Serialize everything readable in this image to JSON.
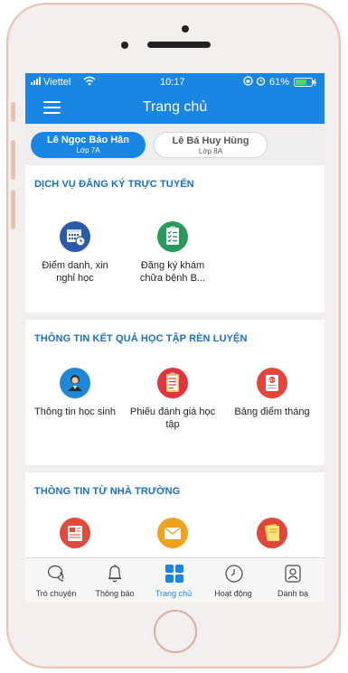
{
  "status": {
    "carrier": "Viettel",
    "time": "10:17",
    "battery": "61%"
  },
  "appbar": {
    "title": "Trang chủ"
  },
  "students": [
    {
      "name": "Lê Ngọc Bảo Hân",
      "class": "Lớp 7A"
    },
    {
      "name": "Lê Bá Huy Hùng",
      "class": "Lớp 8A"
    }
  ],
  "sections": [
    {
      "title": "DỊCH VỤ ĐĂNG KÝ TRỰC TUYẾN",
      "items": [
        {
          "label": "Điểm danh, xin nghỉ học",
          "icon": "attendance-calendar-icon",
          "color": "#2b5aa8"
        },
        {
          "label": "Đăng ký khám chữa bệnh B...",
          "icon": "medical-checklist-icon",
          "color": "#2a9a5c"
        }
      ]
    },
    {
      "title": "THÔNG TIN KẾT QUẢ HỌC TẬP RÈN LUYỆN",
      "items": [
        {
          "label": "Thông tin học sinh",
          "icon": "student-profile-icon",
          "color": "#1e88d6"
        },
        {
          "label": "Phiếu đánh giá học tập",
          "icon": "evaluation-clipboard-icon",
          "color": "#e0353d"
        },
        {
          "label": "Bảng điểm tháng",
          "icon": "grade-report-icon",
          "color": "#e2453a"
        }
      ]
    },
    {
      "title": "THÔNG TIN TỪ NHÀ TRƯỜNG",
      "items": [
        {
          "label": "",
          "icon": "newspaper-icon",
          "color": "#e24b3c"
        },
        {
          "label": "",
          "icon": "envelope-icon",
          "color": "#f0a21e"
        },
        {
          "label": "",
          "icon": "notes-icon",
          "color": "#e2453a"
        }
      ]
    }
  ],
  "tabs": [
    {
      "label": "Trò chuyện",
      "icon": "chat-icon"
    },
    {
      "label": "Thông báo",
      "icon": "bell-icon"
    },
    {
      "label": "Trang chủ",
      "icon": "home-grid-icon",
      "active": true
    },
    {
      "label": "Hoạt động",
      "icon": "clock-icon"
    },
    {
      "label": "Danh bạ",
      "icon": "contacts-icon"
    }
  ]
}
